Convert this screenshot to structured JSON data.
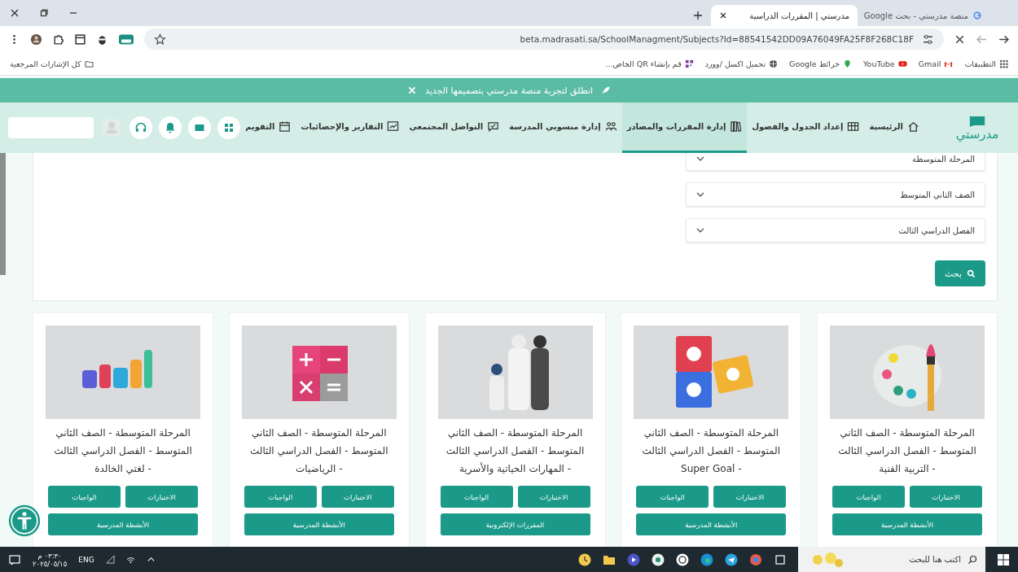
{
  "tabs": [
    {
      "title": "منصة مدرستي - بحث Google",
      "selected": false
    },
    {
      "title": "مدرستي | المقررات الدراسية",
      "selected": true
    }
  ],
  "address_bar": {
    "url": "beta.madrasati.sa/SchoolManagment/Subjects?Id=88541542DD09A76049FA25F8F268C18F"
  },
  "bookmarks": [
    {
      "label": "التطبيقات",
      "kind": "apps"
    },
    {
      "label": "Gmail",
      "kind": "gmail"
    },
    {
      "label": "YouTube",
      "kind": "youtube"
    },
    {
      "label": "خرائط Google",
      "kind": "maps"
    },
    {
      "label": "تحميل اكسل /وورد",
      "kind": "web"
    },
    {
      "label": "قم بإنشاء QR الخاص...",
      "kind": "qr"
    }
  ],
  "all_bookmarks": "كل الإشارات المرجعية",
  "banner": {
    "text": "انطلق لتجربة منصة مدرستي بتصميمها الجديد"
  },
  "logo": "مدرستي",
  "nav": [
    {
      "label": "الرئيسية",
      "kind": "home",
      "selected": false
    },
    {
      "label": "إعداد الجدول والفصول",
      "kind": "table",
      "selected": false
    },
    {
      "label": "إدارة المقررات والمصادر",
      "kind": "books",
      "selected": true
    },
    {
      "label": "إدارة منسوبي المدرسة",
      "kind": "people",
      "selected": false
    },
    {
      "label": "التواصل المجتمعي",
      "kind": "chat",
      "selected": false
    },
    {
      "label": "التقارير والإحصائيات",
      "kind": "chart",
      "selected": false
    },
    {
      "label": "التقويم",
      "kind": "calendar",
      "selected": false
    }
  ],
  "filters": [
    {
      "value": "المرحلة المتوسطة"
    },
    {
      "value": "الصف الثاني المتوسط"
    },
    {
      "value": "الفصل الدراسي الثالث"
    }
  ],
  "search_button": "بحث",
  "courses": [
    {
      "title": "المرحلة المتوسطة - الصف الثاني المتوسط - الفصل الدراسي الثالث - التربية الفنية",
      "kind": "palette",
      "buttons": [
        {
          "label": "الاختبارات",
          "wide": false
        },
        {
          "label": "الواجبات",
          "wide": false
        },
        {
          "label": "الأنشطة المدرسية",
          "wide": true
        }
      ]
    },
    {
      "title": "المرحلة المتوسطة - الصف الثاني المتوسط - الفصل الدراسي الثالث - Super Goal",
      "kind": "blocks",
      "buttons": [
        {
          "label": "الاختبارات",
          "wide": false
        },
        {
          "label": "الواجبات",
          "wide": false
        },
        {
          "label": "الأنشطة المدرسية",
          "wide": true
        }
      ]
    },
    {
      "title": "المرحلة المتوسطة - الصف الثاني المتوسط - الفصل الدراسي الثالث - المهارات الحياتية والأسرية",
      "kind": "family",
      "buttons": [
        {
          "label": "الاختبارات",
          "wide": false
        },
        {
          "label": "الواجبات",
          "wide": false
        },
        {
          "label": "المقررات الإلكترونية",
          "wide": true
        }
      ]
    },
    {
      "title": "المرحلة المتوسطة - الصف الثاني المتوسط - الفصل الدراسي الثالث - الرياضيات",
      "kind": "calculator",
      "buttons": [
        {
          "label": "الاختبارات",
          "wide": false
        },
        {
          "label": "الواجبات",
          "wide": false
        },
        {
          "label": "الأنشطة المدرسية",
          "wide": true
        }
      ]
    },
    {
      "title": "المرحلة المتوسطة - الصف الثاني المتوسط - الفصل الدراسي الثالث - لغتي الخالدة",
      "kind": "letters",
      "buttons": [
        {
          "label": "الاختبارات",
          "wide": false
        },
        {
          "label": "الواجبات",
          "wide": false
        },
        {
          "label": "الأنشطة المدرسية",
          "wide": true
        }
      ]
    }
  ],
  "taskbar": {
    "search_placeholder": "اكتب هنا للبحث",
    "language": "ENG",
    "time": "٠٣:٣٠ م",
    "date": "٢٠٢٥/٠٥/١٥"
  }
}
